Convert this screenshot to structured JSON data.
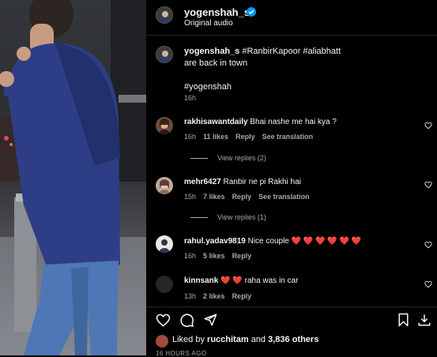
{
  "post": {
    "username": "yogenshah_s",
    "audio": "Original audio",
    "caption_user": "yogenshah_s",
    "caption_tags": "#RanbirKapoor #aliabhatt",
    "caption_line2": "are back in town",
    "caption_tag2": "#yogenshah",
    "caption_time": "16h"
  },
  "comments": [
    {
      "user": "rakhisawantdaily",
      "text": "Bhai nashe me hai kya ?",
      "time": "16h",
      "likes": "11 likes",
      "reply": "Reply",
      "translate": "See translation",
      "view_replies": "View replies (2)"
    },
    {
      "user": "mehr6427",
      "text": "Ranbir ne pi Rakhi hai",
      "time": "15h",
      "likes": "7 likes",
      "reply": "Reply",
      "translate": "See translation",
      "view_replies": "View replies (1)"
    },
    {
      "user": "rahul.yadav9819",
      "text": "Nice couple",
      "emoji": "❤️ ❤️ ❤️ ❤️ ❤️ ❤️",
      "time": "16h",
      "likes": "5 likes",
      "reply": "Reply"
    },
    {
      "user": "kinnsank",
      "emoji": "❤️ ❤️",
      "text": "raha was in car",
      "time": "13h",
      "likes": "2 likes",
      "reply": "Reply"
    }
  ],
  "likes": {
    "prefix": "Liked by",
    "user": "rucchitam",
    "and": "and",
    "others": "3,836 others"
  },
  "ago": "16 HOURS AGO",
  "colors": {
    "verified": "#0095f6",
    "background": "#000000",
    "heart_red": "#ff3040"
  },
  "icons": [
    "verified-badge-icon",
    "heart-icon",
    "comment-icon",
    "share-icon",
    "bookmark-icon",
    "download-icon"
  ]
}
